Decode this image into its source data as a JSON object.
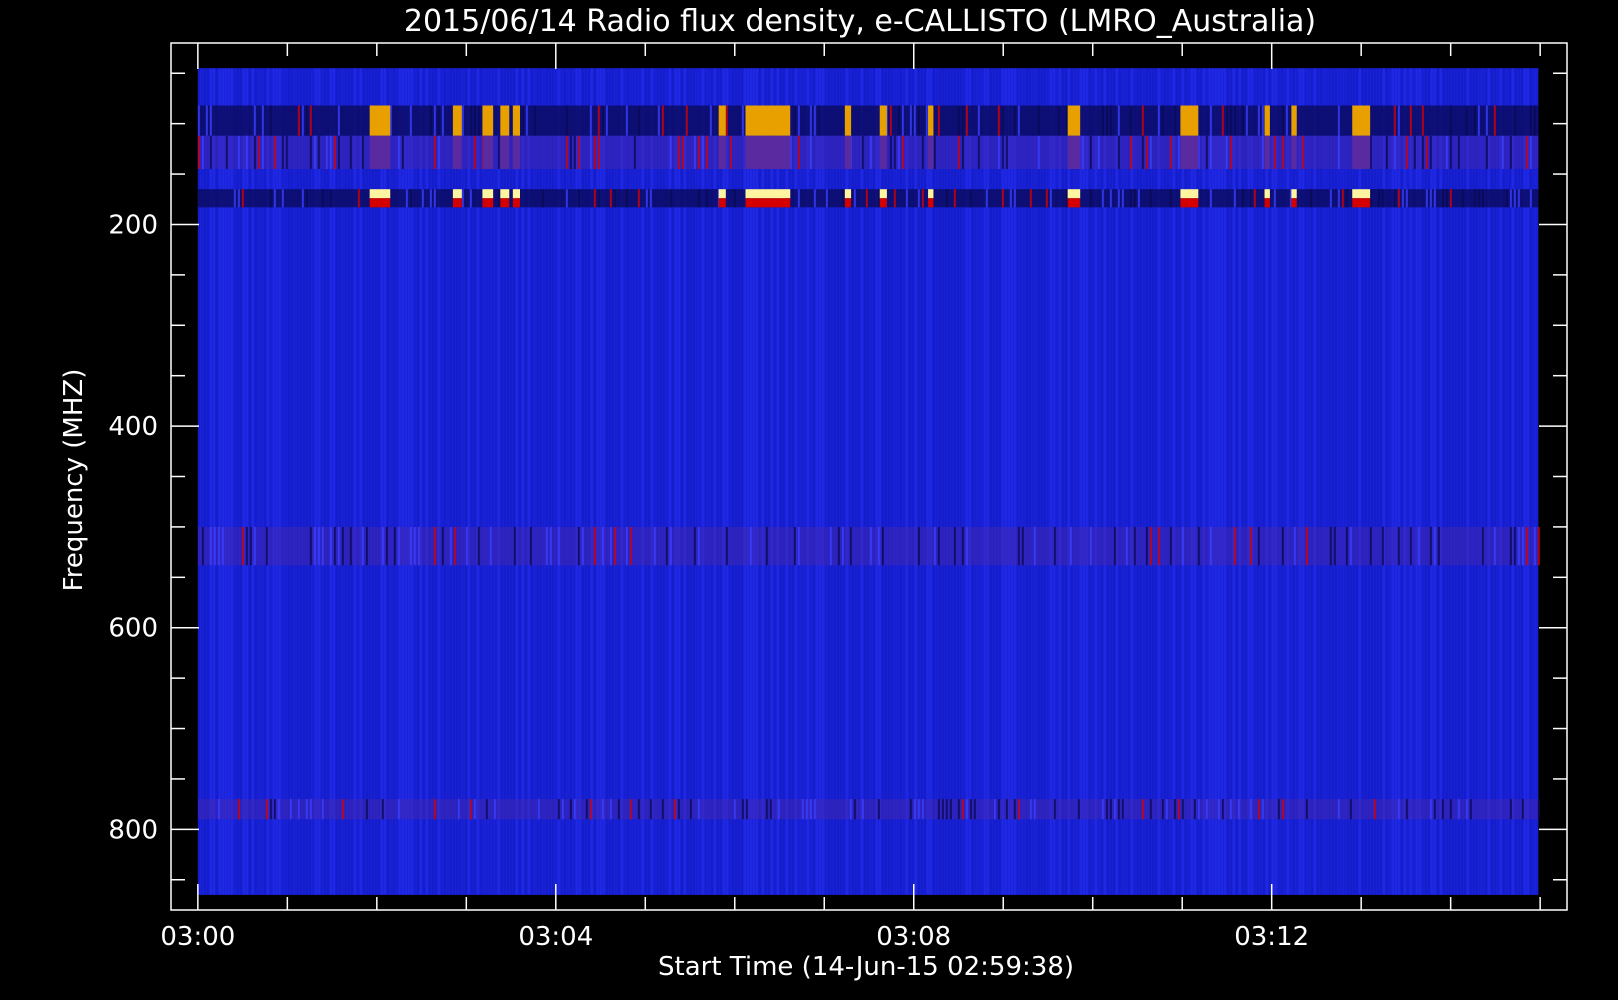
{
  "chart_data": {
    "type": "heatmap",
    "title": "2015/06/14  Radio flux density, e-CALLISTO (LMRO_Australia)",
    "xlabel": "Start Time (14-Jun-15 02:59:38)",
    "ylabel": "Frequency (MHZ)",
    "x_range_minutes_after_0300": [
      -0.3,
      15.3
    ],
    "y_range_mhz": [
      20,
      880
    ],
    "y_inverted": true,
    "data_extent": {
      "x_start_min": 0.0,
      "x_end_min": 14.98,
      "f_low_mhz": 45,
      "f_high_mhz": 865
    },
    "x_ticks": [
      {
        "min": 0,
        "label": "03:00"
      },
      {
        "min": 4,
        "label": "03:04"
      },
      {
        "min": 8,
        "label": "03:08"
      },
      {
        "min": 12,
        "label": "03:12"
      }
    ],
    "y_ticks": [
      {
        "mhz": 200,
        "label": "200"
      },
      {
        "mhz": 400,
        "label": "400"
      },
      {
        "mhz": 600,
        "label": "600"
      },
      {
        "mhz": 800,
        "label": "800"
      }
    ],
    "background_color": "#1a22d8",
    "colors": {
      "dark": "#0a0a55",
      "purple": "#5a2aa0",
      "red": "#d40000",
      "orange": "#e8a000",
      "yellow": "#ffe030",
      "pale": "#fff5a0"
    },
    "bursts": [
      {
        "t_start": 1.92,
        "t_end": 2.15
      },
      {
        "t_start": 2.85,
        "t_end": 2.95
      },
      {
        "t_start": 3.18,
        "t_end": 3.3
      },
      {
        "t_start": 3.38,
        "t_end": 3.48
      },
      {
        "t_start": 3.52,
        "t_end": 3.6
      },
      {
        "t_start": 5.82,
        "t_end": 5.9
      },
      {
        "t_start": 6.12,
        "t_end": 6.62
      },
      {
        "t_start": 7.23,
        "t_end": 7.3
      },
      {
        "t_start": 7.62,
        "t_end": 7.7
      },
      {
        "t_start": 8.16,
        "t_end": 8.22
      },
      {
        "t_start": 9.72,
        "t_end": 9.86
      },
      {
        "t_start": 10.98,
        "t_end": 11.18
      },
      {
        "t_start": 11.92,
        "t_end": 11.98
      },
      {
        "t_start": 12.22,
        "t_end": 12.28
      },
      {
        "t_start": 12.9,
        "t_end": 13.1
      }
    ],
    "bands_mhz": [
      {
        "name": "dark-band",
        "f_low": 82,
        "f_high": 112,
        "color_key": "dark"
      },
      {
        "name": "mid-band",
        "f_low": 112,
        "f_high": 145,
        "color_key": "purple"
      },
      {
        "name": "narrow-band",
        "f_low": 165,
        "f_high": 183,
        "color_key": "dark"
      },
      {
        "name": "band-520",
        "f_low": 500,
        "f_high": 538,
        "color_key": "purple"
      },
      {
        "name": "band-780",
        "f_low": 770,
        "f_high": 790,
        "color_key": "purple"
      }
    ]
  }
}
